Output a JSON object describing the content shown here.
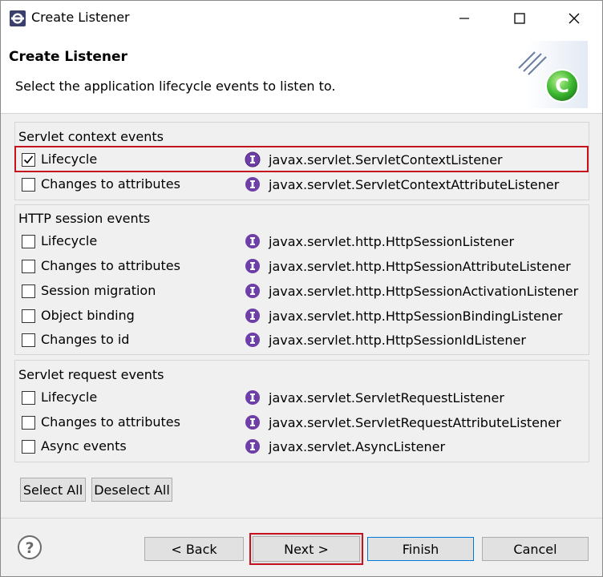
{
  "window": {
    "title": "Create Listener",
    "minimize_glyph": "—",
    "maximize_glyph": "□",
    "close_glyph": "✕"
  },
  "banner": {
    "title": "Create Listener",
    "subtitle": "Select the application lifecycle events to listen to."
  },
  "groups": [
    {
      "label": "Servlet context events",
      "items": [
        {
          "label": "Lifecycle",
          "interface": "javax.servlet.ServletContextListener",
          "checked": true
        },
        {
          "label": "Changes to attributes",
          "interface": "javax.servlet.ServletContextAttributeListener",
          "checked": false
        }
      ]
    },
    {
      "label": "HTTP session events",
      "items": [
        {
          "label": "Lifecycle",
          "interface": "javax.servlet.http.HttpSessionListener",
          "checked": false
        },
        {
          "label": "Changes to attributes",
          "interface": "javax.servlet.http.HttpSessionAttributeListener",
          "checked": false
        },
        {
          "label": "Session migration",
          "interface": "javax.servlet.http.HttpSessionActivationListener",
          "checked": false
        },
        {
          "label": "Object binding",
          "interface": "javax.servlet.http.HttpSessionBindingListener",
          "checked": false
        },
        {
          "label": "Changes to id",
          "interface": "javax.servlet.http.HttpSessionIdListener",
          "checked": false
        }
      ]
    },
    {
      "label": "Servlet request events",
      "items": [
        {
          "label": "Lifecycle",
          "interface": "javax.servlet.ServletRequestListener",
          "checked": false
        },
        {
          "label": "Changes to attributes",
          "interface": "javax.servlet.ServletRequestAttributeListener",
          "checked": false
        },
        {
          "label": "Async events",
          "interface": "javax.servlet.AsyncListener",
          "checked": false
        }
      ]
    }
  ],
  "selection_buttons": {
    "select_all": "Select All",
    "deselect_all": "Deselect All"
  },
  "footer": {
    "help_glyph": "?",
    "back": "< Back",
    "next": "Next >",
    "finish": "Finish",
    "cancel": "Cancel"
  },
  "colors": {
    "highlight": "#c4121e",
    "interface_icon": "#6e3fa6",
    "accent": "#0078d7"
  }
}
